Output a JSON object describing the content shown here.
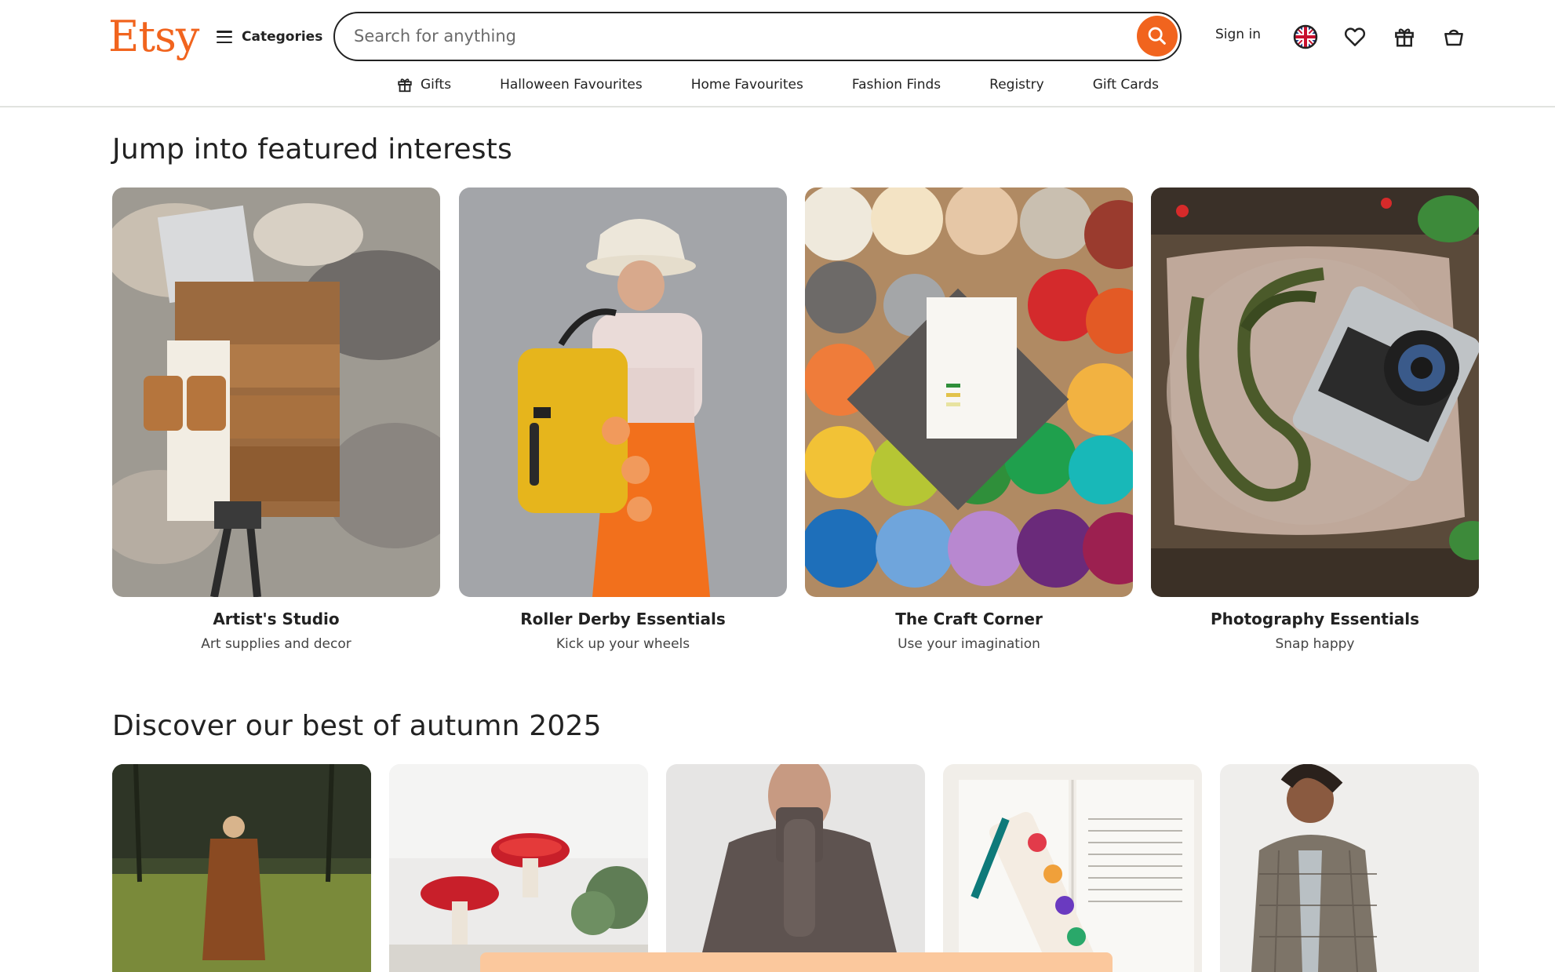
{
  "brand": {
    "logo": "Etsy",
    "accent": "#f1641e"
  },
  "header": {
    "categories_label": "Categories",
    "search_placeholder": "Search for anything",
    "sign_in": "Sign in"
  },
  "subnav": [
    {
      "label": "Gifts",
      "icon": "gift-icon"
    },
    {
      "label": "Halloween Favourites"
    },
    {
      "label": "Home Favourites"
    },
    {
      "label": "Fashion Finds"
    },
    {
      "label": "Registry"
    },
    {
      "label": "Gift Cards"
    }
  ],
  "featured": {
    "title": "Jump into featured interests",
    "items": [
      {
        "name": "Artist's Studio",
        "sub": "Art supplies and decor"
      },
      {
        "name": "Roller Derby Essentials",
        "sub": "Kick up your wheels"
      },
      {
        "name": "The Craft Corner",
        "sub": "Use your imagination"
      },
      {
        "name": "Photography Essentials",
        "sub": "Snap happy"
      }
    ]
  },
  "autumn": {
    "title": "Discover our best of autumn 2025"
  }
}
